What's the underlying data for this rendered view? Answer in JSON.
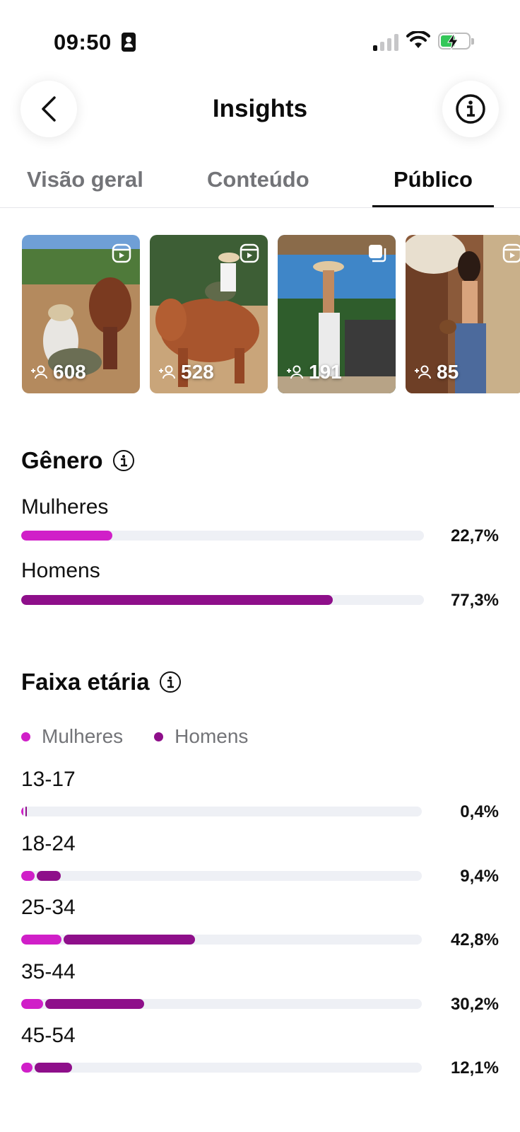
{
  "status_bar": {
    "time": "09:50",
    "icons": [
      "contact-card-icon",
      "cellular-signal-icon",
      "wifi-icon",
      "battery-charging-icon"
    ]
  },
  "header": {
    "title": "Insights",
    "back_icon": "chevron-left-icon",
    "info_icon": "info-icon"
  },
  "tabs": [
    {
      "label": "Visão geral",
      "active": false
    },
    {
      "label": "Conteúdo",
      "active": false
    },
    {
      "label": "Público",
      "active": true
    }
  ],
  "content_thumbnails": [
    {
      "type": "reel",
      "follows": "608"
    },
    {
      "type": "reel",
      "follows": "528"
    },
    {
      "type": "carousel",
      "follows": "191"
    },
    {
      "type": "reel",
      "follows": "85"
    }
  ],
  "gender": {
    "title": "Gênero",
    "rows": [
      {
        "label": "Mulheres",
        "value": 22.7,
        "pct_label": "22,7%"
      },
      {
        "label": "Homens",
        "value": 77.3,
        "pct_label": "77,3%"
      }
    ]
  },
  "age": {
    "title": "Faixa etária",
    "legend": [
      {
        "label": "Mulheres",
        "color": "#d01fc8"
      },
      {
        "label": "Homens",
        "color": "#8e0f8a"
      }
    ],
    "rows": [
      {
        "label": "13-17",
        "total": 0.4,
        "women": 0.2,
        "men": 0.2,
        "pct_label": "0,4%"
      },
      {
        "label": "18-24",
        "total": 9.4,
        "women": 3.3,
        "men": 6.1,
        "pct_label": "9,4%"
      },
      {
        "label": "25-34",
        "total": 42.8,
        "women": 10.0,
        "men": 32.8,
        "pct_label": "42,8%"
      },
      {
        "label": "35-44",
        "total": 30.2,
        "women": 5.5,
        "men": 24.7,
        "pct_label": "30,2%"
      },
      {
        "label": "45-54",
        "total": 12.1,
        "women": 2.8,
        "men": 9.3,
        "pct_label": "12,1%"
      }
    ]
  },
  "colors": {
    "women": "#d01fc8",
    "men": "#8e0f8a",
    "track": "#eef0f5",
    "muted_text": "#737478"
  }
}
